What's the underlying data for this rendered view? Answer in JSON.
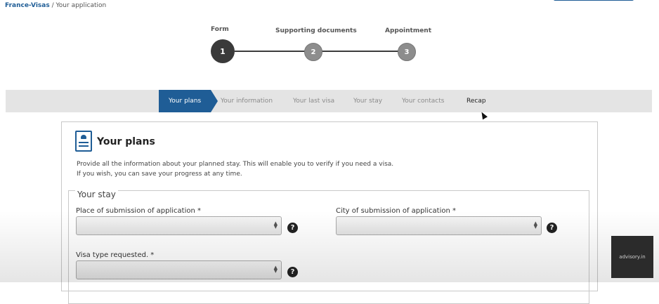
{
  "breadcrumb": {
    "root": "France-Visas",
    "separator": "/",
    "current": "Your application"
  },
  "stepper": {
    "steps": [
      {
        "number": "1",
        "label": "Form"
      },
      {
        "number": "2",
        "label": "Supporting documents"
      },
      {
        "number": "3",
        "label": "Appointment"
      }
    ]
  },
  "tabs": [
    {
      "label": "Your plans"
    },
    {
      "label": "Your information"
    },
    {
      "label": "Your last visa"
    },
    {
      "label": "Your stay"
    },
    {
      "label": "Your contacts"
    },
    {
      "label": "Recap"
    }
  ],
  "panel": {
    "title": "Your plans",
    "intro_line1": "Provide all the information about your planned stay. This will enable you to verify if you need a visa.",
    "intro_line2": "If you wish, you can save your progress at any time.",
    "section_legend": "Your stay",
    "fields": {
      "place": {
        "label": "Place of submission of application *",
        "value": ""
      },
      "city": {
        "label": "City of submission of application *",
        "value": ""
      },
      "visa": {
        "label": "Visa type requested. *",
        "value": ""
      }
    },
    "help_glyph": "?"
  },
  "watermark": "advisory.in",
  "colors": {
    "accent": "#1f5d96",
    "step_active": "#3a3a3a",
    "step_inactive": "#8d8d8d"
  }
}
